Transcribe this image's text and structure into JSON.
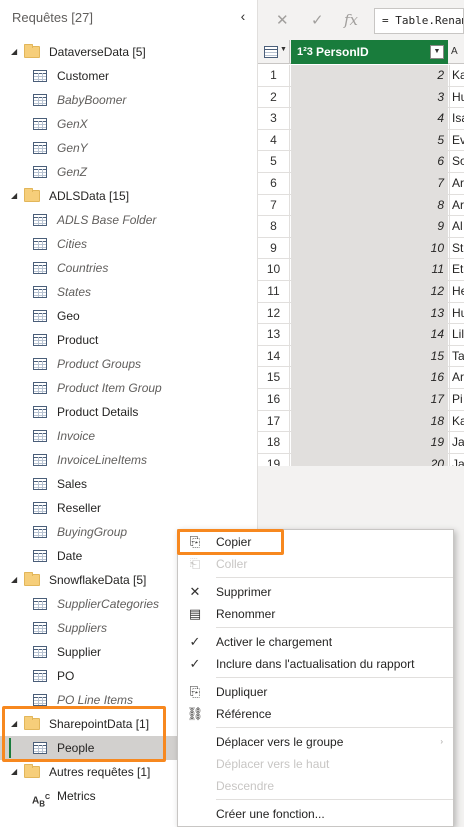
{
  "queries_pane": {
    "header": "Requêtes [27]",
    "collapse_icon": "‹",
    "groups": [
      {
        "name": "DataverseData [5]",
        "items": [
          {
            "label": "Customer",
            "italic": false
          },
          {
            "label": "BabyBoomer",
            "italic": true
          },
          {
            "label": "GenX",
            "italic": true
          },
          {
            "label": "GenY",
            "italic": true
          },
          {
            "label": "GenZ",
            "italic": true
          }
        ]
      },
      {
        "name": "ADLSData [15]",
        "items": [
          {
            "label": "ADLS Base Folder",
            "italic": true
          },
          {
            "label": "Cities",
            "italic": true
          },
          {
            "label": "Countries",
            "italic": true
          },
          {
            "label": "States",
            "italic": true
          },
          {
            "label": "Geo",
            "italic": false
          },
          {
            "label": "Product",
            "italic": false
          },
          {
            "label": "Product Groups",
            "italic": true
          },
          {
            "label": "Product Item Group",
            "italic": true
          },
          {
            "label": "Product Details",
            "italic": false
          },
          {
            "label": "Invoice",
            "italic": true
          },
          {
            "label": "InvoiceLineItems",
            "italic": true
          },
          {
            "label": "Sales",
            "italic": false
          },
          {
            "label": "Reseller",
            "italic": false
          },
          {
            "label": "BuyingGroup",
            "italic": true
          },
          {
            "label": "Date",
            "italic": false
          }
        ]
      },
      {
        "name": "SnowflakeData [5]",
        "items": [
          {
            "label": "SupplierCategories",
            "italic": true
          },
          {
            "label": "Suppliers",
            "italic": true
          },
          {
            "label": "Supplier",
            "italic": false
          },
          {
            "label": "PO",
            "italic": false
          },
          {
            "label": "PO Line Items",
            "italic": true
          }
        ]
      },
      {
        "name": "SharepointData [1]",
        "items": [
          {
            "label": "People",
            "italic": false,
            "selected": true
          }
        ]
      },
      {
        "name": "Autres requêtes [1]",
        "items": [
          {
            "label": "Metrics",
            "italic": false,
            "icon": "abc"
          }
        ]
      }
    ]
  },
  "formula_bar": {
    "cancel_icon": "✕",
    "confirm_icon": "✓",
    "fx_label": "fx",
    "formula": "= Table.RenameColumns"
  },
  "grid": {
    "column_header": "PersonID",
    "column_type": "1²3",
    "next_column_type": "A",
    "rows": [
      {
        "n": "1",
        "id": "2",
        "next": "Ka"
      },
      {
        "n": "2",
        "id": "3",
        "next": "Hu"
      },
      {
        "n": "3",
        "id": "4",
        "next": "Isa"
      },
      {
        "n": "4",
        "id": "5",
        "next": "Ev"
      },
      {
        "n": "5",
        "id": "6",
        "next": "So"
      },
      {
        "n": "6",
        "id": "7",
        "next": "Ar"
      },
      {
        "n": "7",
        "id": "8",
        "next": "Ar"
      },
      {
        "n": "8",
        "id": "9",
        "next": "Al"
      },
      {
        "n": "9",
        "id": "10",
        "next": "St"
      },
      {
        "n": "10",
        "id": "11",
        "next": "Et"
      },
      {
        "n": "11",
        "id": "12",
        "next": "He"
      },
      {
        "n": "12",
        "id": "13",
        "next": "Hu"
      },
      {
        "n": "13",
        "id": "14",
        "next": "Lil"
      },
      {
        "n": "14",
        "id": "15",
        "next": "Ta"
      },
      {
        "n": "15",
        "id": "16",
        "next": "Ar"
      },
      {
        "n": "16",
        "id": "17",
        "next": "Pi"
      },
      {
        "n": "17",
        "id": "18",
        "next": "Ka"
      },
      {
        "n": "18",
        "id": "19",
        "next": "Ja"
      },
      {
        "n": "19",
        "id": "20",
        "next": "Ja"
      }
    ]
  },
  "context_menu": {
    "items": [
      {
        "label": "Copier",
        "icon": "copy-icon",
        "glyph": "⎘",
        "disabled": false
      },
      {
        "label": "Coller",
        "icon": "paste-icon",
        "glyph": "⎗",
        "disabled": true
      },
      {
        "label": "Supprimer",
        "icon": "delete-icon",
        "glyph": "✕",
        "disabled": false
      },
      {
        "label": "Renommer",
        "icon": "rename-icon",
        "glyph": "▤",
        "disabled": false
      },
      {
        "label": "Activer le chargement",
        "icon": "check-icon",
        "glyph": "✓",
        "disabled": false
      },
      {
        "label": "Inclure dans l'actualisation du rapport",
        "icon": "check-icon",
        "glyph": "✓",
        "disabled": false
      },
      {
        "label": "Dupliquer",
        "icon": "duplicate-icon",
        "glyph": "⎘",
        "disabled": false
      },
      {
        "label": "Référence",
        "icon": "link-icon",
        "glyph": "⛓",
        "disabled": false
      },
      {
        "label": "Déplacer vers le groupe",
        "icon": "",
        "glyph": "",
        "disabled": false,
        "submenu": true
      },
      {
        "label": "Déplacer vers le haut",
        "icon": "",
        "glyph": "",
        "disabled": true
      },
      {
        "label": "Descendre",
        "icon": "",
        "glyph": "",
        "disabled": true
      },
      {
        "label": "Créer une fonction...",
        "icon": "",
        "glyph": "",
        "disabled": false
      }
    ],
    "submenu_arrow": "›"
  },
  "colors": {
    "accent_green": "#197c3c",
    "highlight_orange": "#f7881f",
    "folder_yellow": "#f6ce7a"
  }
}
